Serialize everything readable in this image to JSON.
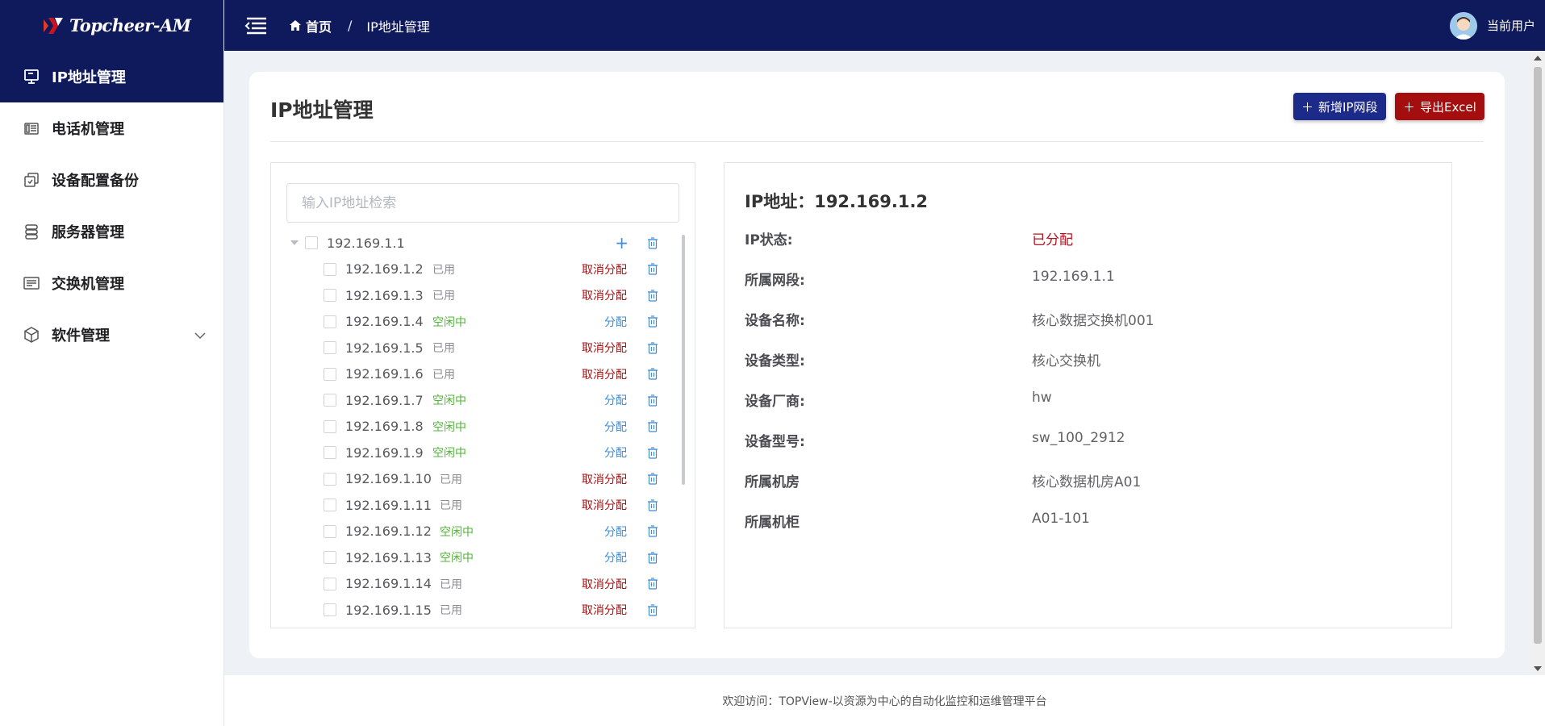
{
  "app": {
    "logo_text": "Topcheer-AM"
  },
  "sidebar": {
    "items": [
      {
        "label": "IP地址管理",
        "icon": "monitor-icon",
        "active": true
      },
      {
        "label": "电话机管理",
        "icon": "phone-icon"
      },
      {
        "label": "设备配置备份",
        "icon": "backup-icon"
      },
      {
        "label": "服务器管理",
        "icon": "server-icon"
      },
      {
        "label": "交换机管理",
        "icon": "switch-icon"
      },
      {
        "label": "软件管理",
        "icon": "package-icon",
        "expandable": true
      }
    ]
  },
  "header": {
    "breadcrumb_home": "首页",
    "breadcrumb_separator": "/",
    "breadcrumb_current": "IP地址管理",
    "user_name": "当前用户"
  },
  "page": {
    "title": "IP地址管理",
    "add_button": "新增IP网段",
    "export_button": "导出Excel"
  },
  "tree": {
    "search_placeholder": "输入IP地址检索",
    "parent": {
      "ip": "192.169.1.1"
    },
    "children": [
      {
        "ip": "192.169.1.2",
        "status": "已用",
        "status_type": "used",
        "action": "取消分配"
      },
      {
        "ip": "192.169.1.3",
        "status": "已用",
        "status_type": "used",
        "action": "取消分配"
      },
      {
        "ip": "192.169.1.4",
        "status": "空闲中",
        "status_type": "free",
        "action": "分配"
      },
      {
        "ip": "192.169.1.5",
        "status": "已用",
        "status_type": "used",
        "action": "取消分配"
      },
      {
        "ip": "192.169.1.6",
        "status": "已用",
        "status_type": "used",
        "action": "取消分配"
      },
      {
        "ip": "192.169.1.7",
        "status": "空闲中",
        "status_type": "free",
        "action": "分配"
      },
      {
        "ip": "192.169.1.8",
        "status": "空闲中",
        "status_type": "free",
        "action": "分配"
      },
      {
        "ip": "192.169.1.9",
        "status": "空闲中",
        "status_type": "free",
        "action": "分配"
      },
      {
        "ip": "192.169.1.10",
        "status": "已用",
        "status_type": "used",
        "action": "取消分配"
      },
      {
        "ip": "192.169.1.11",
        "status": "已用",
        "status_type": "used",
        "action": "取消分配"
      },
      {
        "ip": "192.169.1.12",
        "status": "空闲中",
        "status_type": "free",
        "action": "分配"
      },
      {
        "ip": "192.169.1.13",
        "status": "空闲中",
        "status_type": "free",
        "action": "分配"
      },
      {
        "ip": "192.169.1.14",
        "status": "已用",
        "status_type": "used",
        "action": "取消分配"
      },
      {
        "ip": "192.169.1.15",
        "status": "已用",
        "status_type": "used",
        "action": "取消分配"
      }
    ]
  },
  "detail": {
    "title": "IP地址：192.169.1.2",
    "fields": [
      {
        "label": "IP状态:",
        "value": "已分配",
        "highlight": true
      },
      {
        "label": "所属网段:",
        "value": "192.169.1.1"
      },
      {
        "label": "设备名称:",
        "value": "核心数据交换机001"
      },
      {
        "label": "设备类型:",
        "value": "核心交换机"
      },
      {
        "label": "设备厂商:",
        "value": "hw"
      },
      {
        "label": "设备型号:",
        "value": "sw_100_2912"
      },
      {
        "label": "所属机房",
        "value": "核心数据机房A01"
      },
      {
        "label": "所属机柜",
        "value": "A01-101"
      }
    ]
  },
  "footer": {
    "text": "欢迎访问：TOPView-以资源为中心的自动化监控和运维管理平台"
  },
  "colors": {
    "navy": "#0f1a5c",
    "brand_red": "#a50e0e",
    "free_green": "#53b53a",
    "assign_blue": "#3e8bd8",
    "cancel_red": "#a31313"
  }
}
